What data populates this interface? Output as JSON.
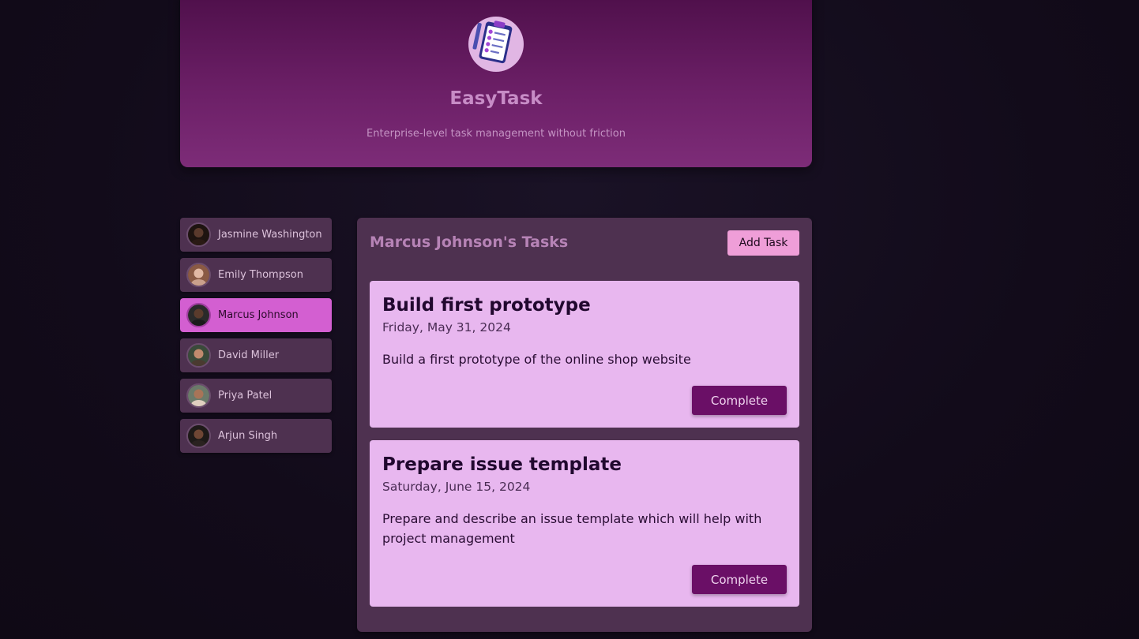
{
  "app": {
    "title": "EasyTask",
    "subtitle": "Enterprise-level task management without friction",
    "logo_icon": "clipboard-checklist-icon"
  },
  "users": [
    {
      "name": "Jasmine Washington",
      "active": false,
      "avatar_tone": "#3a2620"
    },
    {
      "name": "Emily Thompson",
      "active": false,
      "avatar_tone": "#c99a86"
    },
    {
      "name": "Marcus Johnson",
      "active": true,
      "avatar_tone": "#3d2a22"
    },
    {
      "name": "David Miller",
      "active": false,
      "avatar_tone": "#8a6450"
    },
    {
      "name": "Priya Patel",
      "active": false,
      "avatar_tone": "#7d5a48"
    },
    {
      "name": "Arjun Singh",
      "active": false,
      "avatar_tone": "#4a3026"
    }
  ],
  "tasks_panel": {
    "title": "Marcus Johnson's Tasks",
    "add_label": "Add Task",
    "tasks": [
      {
        "title": "Build first prototype",
        "date": "Friday, May 31, 2024",
        "description": "Build a first prototype of the online shop website",
        "action_label": "Complete"
      },
      {
        "title": "Prepare issue template",
        "date": "Saturday, June 15, 2024",
        "description": "Prepare and describe an issue template which will help with project management",
        "action_label": "Complete"
      }
    ]
  },
  "colors": {
    "header_gradient_top": "#4e0f4a",
    "header_gradient_bottom": "#7d2c78",
    "panel_bg": "#4e3150",
    "active_user": "#d35fd1",
    "task_card": "#e8b7ef",
    "complete_button": "#6a0f66",
    "add_button": "#ef9ed8"
  }
}
